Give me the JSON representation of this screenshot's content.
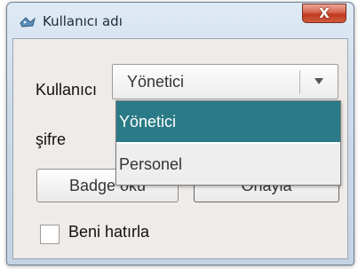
{
  "window": {
    "title": "Kullanıcı adı",
    "close_symbol": "X"
  },
  "form": {
    "user_label": "Kullanıcı",
    "password_label": "şifre",
    "role_select": {
      "selected": "Yönetici",
      "options": [
        "Yönetici",
        "Personel"
      ],
      "arrow_icon": "triangle-down-icon"
    },
    "badge_button_label": "Badge oku",
    "login_button_label": "Onayla",
    "remember_label": "Beni hatırla",
    "remember_checked": false
  },
  "colors": {
    "selection": "#2a7b87",
    "close_button": "#c0391f",
    "dialog_background": "#eeebe8"
  }
}
